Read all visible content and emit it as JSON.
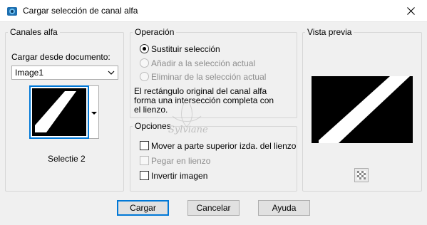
{
  "window": {
    "title": "Cargar selección de canal alfa",
    "close_glyph": "✕"
  },
  "canales": {
    "legend": "Canales alfa",
    "load_from_label": "Cargar desde documento:",
    "document_value": "Image1",
    "channel_name": "Selectie 2"
  },
  "operacion": {
    "legend": "Operación",
    "options": [
      {
        "label": "Sustituir selección",
        "selected": true,
        "enabled": true
      },
      {
        "label": "Añadir a la selección actual",
        "selected": false,
        "enabled": false
      },
      {
        "label": "Eliminar de la selección actual",
        "selected": false,
        "enabled": false
      }
    ],
    "note_lines": [
      "El rectángulo original del canal alfa",
      "forma una intersección completa con",
      "el lienzo."
    ]
  },
  "opciones": {
    "legend": "Opciones",
    "items": [
      {
        "label": "Mover a parte superior izda. del lienzo",
        "checked": false,
        "enabled": true
      },
      {
        "label": "Pegar en lienzo",
        "checked": false,
        "enabled": false
      },
      {
        "label": "Invertir imagen",
        "checked": false,
        "enabled": true
      }
    ]
  },
  "vista": {
    "legend": "Vista previa"
  },
  "watermark": {
    "text": "Sylviane"
  },
  "buttons": {
    "load": "Cargar",
    "cancel": "Cancelar",
    "help": "Ayuda"
  },
  "colors": {
    "accent": "#0078d7",
    "dialog_bg": "#f0f0f0",
    "preview_bg": "#000000",
    "stripe": "#ffffff"
  },
  "icons": {
    "app": "paint-shop-pro-icon",
    "close": "close-icon",
    "dropdown": "chevron-down-icon",
    "preview_toggle": "checkerboard-icon"
  }
}
